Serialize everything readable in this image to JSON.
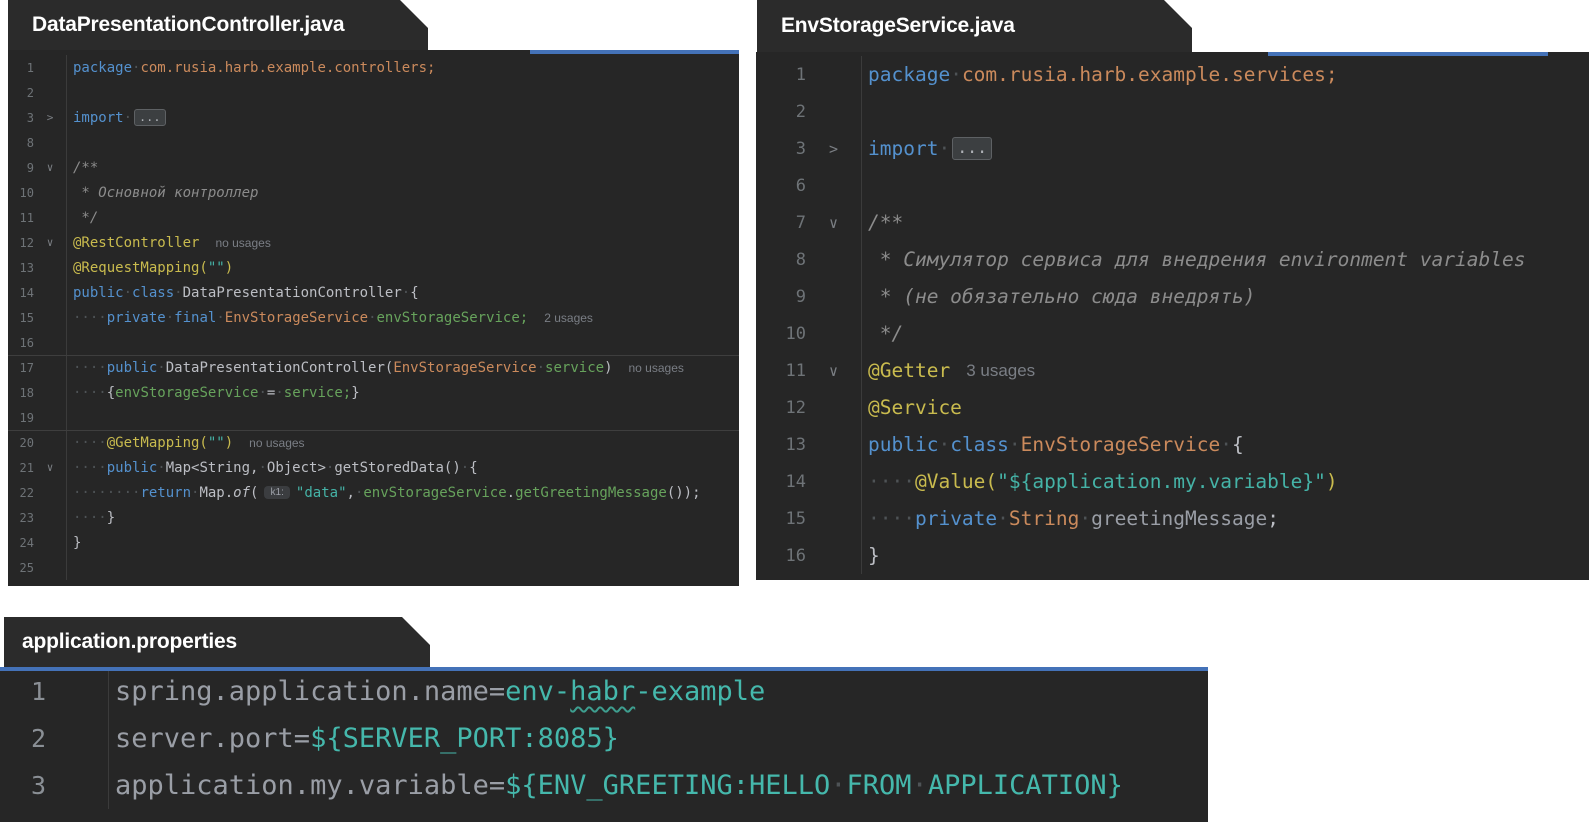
{
  "theme": {
    "page_bg": "#FFFFFF",
    "panel_bg": "#262626",
    "tab_bg": "#2B2B2B",
    "tab_text": "#FFFFFF",
    "accent_blue": "#4472B8",
    "keyword_blue": "#5491CE",
    "type_orange": "#CB8A5C",
    "annotation_yellow": "#C9BB4E",
    "string_teal": "#45B3A7",
    "field_green": "#67A35C",
    "comment_gray": "#8C8C8C",
    "plain_text": "#BCBEC4",
    "line_number_gray": "#6E7377",
    "usage_note_gray": "#7A7E85",
    "properties_key_gray": "#9A9EA6",
    "properties_value_teal": "#45B8AC",
    "wavy_underline": "#3E9E8F"
  },
  "panels": [
    {
      "id": "controller",
      "tab": "DataPresentationController.java",
      "lines": [
        {
          "num": "1",
          "fold": "",
          "tokens": [
            [
              "kw",
              "package"
            ],
            [
              "ws",
              "·"
            ],
            [
              "pkg",
              "com.rusia.harb.example.controllers;"
            ]
          ]
        },
        {
          "num": "2",
          "fold": "",
          "tokens": []
        },
        {
          "num": "3",
          "fold": "collapsed",
          "tokens": [
            [
              "kw",
              "import"
            ],
            [
              "ws",
              "·"
            ],
            [
              "fold",
              "..."
            ]
          ]
        },
        {
          "num": "8",
          "fold": "",
          "tokens": []
        },
        {
          "num": "9",
          "fold": "expanded",
          "tokens": [
            [
              "doc",
              "/**"
            ]
          ]
        },
        {
          "num": "10",
          "fold": "",
          "tokens": [
            [
              "doc",
              " * Основной контроллер"
            ]
          ]
        },
        {
          "num": "11",
          "fold": "",
          "tokens": [
            [
              "doc",
              " */"
            ]
          ]
        },
        {
          "num": "12",
          "fold": "expanded",
          "tokens": [
            [
              "ann",
              "@RestController"
            ],
            [
              "note",
              "no usages"
            ]
          ]
        },
        {
          "num": "13",
          "fold": "",
          "tokens": [
            [
              "ann",
              "@RequestMapping("
            ],
            [
              "str",
              "\"\""
            ],
            [
              "ann",
              ")"
            ]
          ]
        },
        {
          "num": "14",
          "fold": "",
          "tokens": [
            [
              "kw",
              "public"
            ],
            [
              "ws",
              "·"
            ],
            [
              "kw",
              "class"
            ],
            [
              "ws",
              "·"
            ],
            [
              "plain",
              "DataPresentationController"
            ],
            [
              "ws",
              "·"
            ],
            [
              "plain",
              "{"
            ]
          ]
        },
        {
          "num": "15",
          "fold": "",
          "tokens": [
            [
              "ws",
              "····"
            ],
            [
              "kw",
              "private"
            ],
            [
              "ws",
              "·"
            ],
            [
              "kw",
              "final"
            ],
            [
              "ws",
              "·"
            ],
            [
              "type",
              "EnvStorageService"
            ],
            [
              "ws",
              "·"
            ],
            [
              "field",
              "envStorageService;"
            ],
            [
              "note",
              "2 usages"
            ]
          ]
        },
        {
          "num": "16",
          "fold": "",
          "tokens": []
        },
        {
          "num": "17",
          "fold": "",
          "sep": true,
          "tokens": [
            [
              "ws",
              "····"
            ],
            [
              "kw",
              "public"
            ],
            [
              "ws",
              "·"
            ],
            [
              "plain",
              "DataPresentationController("
            ],
            [
              "type",
              "EnvStorageService"
            ],
            [
              "ws",
              "·"
            ],
            [
              "field",
              "service"
            ],
            [
              "plain",
              ")"
            ],
            [
              "note",
              "no usages"
            ]
          ]
        },
        {
          "num": "18",
          "fold": "",
          "tokens": [
            [
              "ws",
              "····"
            ],
            [
              "plain",
              "{"
            ],
            [
              "field",
              "envStorageService"
            ],
            [
              "ws",
              "·"
            ],
            [
              "plain",
              "="
            ],
            [
              "ws",
              "·"
            ],
            [
              "field",
              "service;"
            ],
            [
              "plain",
              "}"
            ]
          ]
        },
        {
          "num": "19",
          "fold": "",
          "tokens": []
        },
        {
          "num": "20",
          "fold": "",
          "sep": true,
          "tokens": [
            [
              "ws",
              "····"
            ],
            [
              "ann",
              "@GetMapping("
            ],
            [
              "str",
              "\"\""
            ],
            [
              "ann",
              ")"
            ],
            [
              "note",
              "no usages"
            ]
          ]
        },
        {
          "num": "21",
          "fold": "expanded",
          "tokens": [
            [
              "ws",
              "····"
            ],
            [
              "kw",
              "public"
            ],
            [
              "ws",
              "·"
            ],
            [
              "plain",
              "Map<String,"
            ],
            [
              "ws",
              "·"
            ],
            [
              "plain",
              "Object>"
            ],
            [
              "ws",
              "·"
            ],
            [
              "plain",
              "getStoredData()"
            ],
            [
              "ws",
              "·"
            ],
            [
              "plain",
              "{"
            ]
          ]
        },
        {
          "num": "22",
          "fold": "",
          "tokens": [
            [
              "ws",
              "········"
            ],
            [
              "kw",
              "return"
            ],
            [
              "ws",
              "·"
            ],
            [
              "plain",
              "Map."
            ],
            [
              "ital",
              "of"
            ],
            [
              "plain",
              "("
            ],
            [
              "inlay",
              "k1:"
            ],
            [
              "str",
              "\"data\""
            ],
            [
              "plain",
              ","
            ],
            [
              "ws",
              "·"
            ],
            [
              "field",
              "envStorageService"
            ],
            [
              "plain",
              "."
            ],
            [
              "field",
              "getGreetingMessage"
            ],
            [
              "plain",
              "());"
            ]
          ]
        },
        {
          "num": "23",
          "fold": "",
          "tokens": [
            [
              "ws",
              "····"
            ],
            [
              "plain",
              "}"
            ]
          ]
        },
        {
          "num": "24",
          "fold": "",
          "tokens": [
            [
              "plain",
              "}"
            ]
          ]
        },
        {
          "num": "25",
          "fold": "",
          "tokens": []
        }
      ]
    },
    {
      "id": "service",
      "tab": "EnvStorageService.java",
      "lines": [
        {
          "num": "1",
          "fold": "",
          "tokens": [
            [
              "kw",
              "package"
            ],
            [
              "ws",
              "·"
            ],
            [
              "pkg",
              "com.rusia.harb.example.services;"
            ]
          ]
        },
        {
          "num": "2",
          "fold": "",
          "tokens": []
        },
        {
          "num": "3",
          "fold": "collapsed",
          "tokens": [
            [
              "kw",
              "import"
            ],
            [
              "ws",
              "·"
            ],
            [
              "fold",
              "..."
            ]
          ]
        },
        {
          "num": "6",
          "fold": "",
          "tokens": []
        },
        {
          "num": "7",
          "fold": "expanded",
          "tokens": [
            [
              "doc",
              "/**"
            ]
          ]
        },
        {
          "num": "8",
          "fold": "",
          "tokens": [
            [
              "doc",
              " * Симулятор сервиса для внедрения environment variables"
            ]
          ]
        },
        {
          "num": "9",
          "fold": "",
          "tokens": [
            [
              "doc",
              " * (не обязательно сюда внедрять)"
            ]
          ]
        },
        {
          "num": "10",
          "fold": "",
          "tokens": [
            [
              "doc",
              " */"
            ]
          ]
        },
        {
          "num": "11",
          "fold": "expanded",
          "tokens": [
            [
              "ann",
              "@Getter"
            ],
            [
              "note",
              "3 usages"
            ]
          ]
        },
        {
          "num": "12",
          "fold": "",
          "tokens": [
            [
              "ann",
              "@Service"
            ]
          ]
        },
        {
          "num": "13",
          "fold": "",
          "tokens": [
            [
              "kw",
              "public"
            ],
            [
              "ws",
              "·"
            ],
            [
              "kw",
              "class"
            ],
            [
              "ws",
              "·"
            ],
            [
              "type",
              "EnvStorageService"
            ],
            [
              "ws",
              "·"
            ],
            [
              "plain",
              "{"
            ]
          ]
        },
        {
          "num": "14",
          "fold": "",
          "tokens": [
            [
              "ws",
              "····"
            ],
            [
              "ann",
              "@Value("
            ],
            [
              "str",
              "\"${application.my.variable}\""
            ],
            [
              "ann",
              ")"
            ]
          ]
        },
        {
          "num": "15",
          "fold": "",
          "tokens": [
            [
              "ws",
              "····"
            ],
            [
              "kw",
              "private"
            ],
            [
              "ws",
              "·"
            ],
            [
              "type",
              "String"
            ],
            [
              "ws",
              "·"
            ],
            [
              "key",
              "greetingMessage"
            ],
            [
              "plain",
              ";"
            ]
          ]
        },
        {
          "num": "16",
          "fold": "",
          "tokens": [
            [
              "plain",
              "}"
            ]
          ]
        }
      ]
    },
    {
      "id": "properties",
      "tab": "application.properties",
      "lines": [
        {
          "num": "1",
          "fold": "",
          "tokens": [
            [
              "key",
              "spring.application.name="
            ],
            [
              "val",
              "env-"
            ],
            [
              "wavy",
              "habr"
            ],
            [
              "val",
              "-example"
            ]
          ]
        },
        {
          "num": "2",
          "fold": "",
          "tokens": [
            [
              "key",
              "server.port="
            ],
            [
              "val",
              "${SERVER_PORT:8085}"
            ]
          ]
        },
        {
          "num": "3",
          "fold": "",
          "tokens": [
            [
              "key",
              "application.my.variable="
            ],
            [
              "val",
              "${ENV_GREETING:HELLO"
            ],
            [
              "ws",
              "·"
            ],
            [
              "val",
              "FROM"
            ],
            [
              "ws",
              "·"
            ],
            [
              "val",
              "APPLICATION}"
            ]
          ]
        }
      ]
    }
  ]
}
